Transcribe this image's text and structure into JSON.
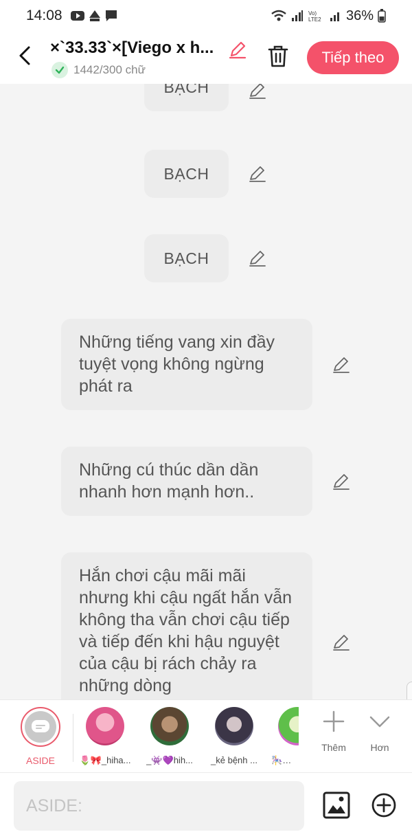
{
  "status_bar": {
    "time": "14:08",
    "battery": "36%"
  },
  "header": {
    "title": "×`33.33`×[Viego x h...",
    "word_count": "1442/300 chữ",
    "next_label": "Tiếp theo"
  },
  "messages": [
    {
      "text": "BẠCH",
      "type": "short"
    },
    {
      "text": "BẠCH",
      "type": "short"
    },
    {
      "text": "BẠCH",
      "type": "short"
    },
    {
      "text": "Những tiếng vang xin đầy tuyệt vọng không ngừng phát ra",
      "type": "long"
    },
    {
      "text": "Những cú thúc dần dần nhanh hơn mạnh hơn..",
      "type": "long"
    },
    {
      "text": "Hắn chơi cậu mãi mãi nhưng khi cậu ngất hắn vẫn không tha vẫn chơi cậu tiếp và tiếp đến khi hậu nguyệt của cậu bị rách chảy ra những dòng",
      "type": "long"
    }
  ],
  "characters": {
    "aside_label": "ASIDE",
    "items": [
      {
        "name": "🌷🎀_hiha..."
      },
      {
        "name": "_👾💜hih..."
      },
      {
        "name": "_kẻ bệnh ..."
      },
      {
        "name": "🎠🎡..."
      }
    ],
    "more_label": "Thêm",
    "less_label": "Hơn"
  },
  "input": {
    "placeholder": "ASIDE:"
  },
  "colors": {
    "accent": "#f4526a",
    "bubble": "#ececec",
    "background": "#f4f4f4"
  }
}
